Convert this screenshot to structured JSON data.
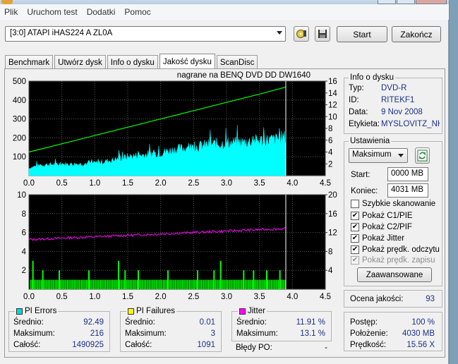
{
  "menu": [
    "Plik",
    "Uruchom test",
    "Dodatki",
    "Pomoc"
  ],
  "toolbar": {
    "drive": "[3:0]   ATAPI iHAS224   A ZL0A",
    "start_label": "Start",
    "exit_label": "Zakończ"
  },
  "tabs": [
    "Benchmark",
    "Utwórz dysk",
    "Info o dysku",
    "Jakość dysku",
    "ScanDisc"
  ],
  "active_tab": "Jakość dysku",
  "chart_caption": "nagrane na BENQ     DVD DD DW1640",
  "chart_data": [
    {
      "type": "area",
      "series": [
        {
          "name": "PI Errors",
          "color": "#00ffff",
          "x": [
            0.0,
            0.1,
            0.25,
            0.5,
            0.75,
            1.0,
            1.25,
            1.5,
            1.75,
            2.0,
            2.25,
            2.5,
            2.75,
            3.0,
            3.25,
            3.5,
            3.75,
            3.85,
            3.9
          ],
          "y": [
            40,
            50,
            58,
            60,
            62,
            66,
            80,
            100,
            110,
            120,
            140,
            150,
            165,
            170,
            175,
            185,
            190,
            200,
            200
          ]
        },
        {
          "name": "Read speed",
          "color": "#00ff00",
          "x": [
            0.0,
            0.5,
            1.0,
            1.5,
            2.0,
            2.5,
            3.0,
            3.5,
            3.9
          ],
          "y": [
            4.0,
            5.4,
            6.8,
            8.2,
            9.6,
            11.0,
            12.4,
            13.8,
            15.0
          ]
        }
      ],
      "xlim": [
        0.0,
        4.5
      ],
      "ylim_left": [
        0,
        500
      ],
      "ylim_right": [
        0,
        16
      ],
      "x_ticks": [
        "0.0",
        "0.5",
        "1.0",
        "1.5",
        "2.0",
        "2.5",
        "3.0",
        "3.5",
        "4.0",
        "4.5"
      ],
      "y_ticks_left": [
        "100",
        "200",
        "300",
        "400",
        "500"
      ],
      "y_ticks_right": [
        "2",
        "4",
        "6",
        "8",
        "10",
        "12",
        "14",
        "16"
      ]
    },
    {
      "type": "bar",
      "series": [
        {
          "name": "PI Failures",
          "color": "#00ff00",
          "x": [
            0.05,
            0.2,
            0.45,
            0.9,
            1.35,
            1.45,
            1.65,
            2.1,
            2.55,
            2.8,
            2.9,
            3.25,
            3.4,
            3.6,
            3.8
          ],
          "y": [
            3,
            2,
            2,
            2,
            3,
            2,
            2,
            2,
            2,
            2,
            3,
            2,
            2,
            2,
            2
          ],
          "baseline": 1
        },
        {
          "name": "Jitter",
          "color": "#ff00ff",
          "x": [
            0.0,
            0.5,
            1.0,
            1.5,
            2.0,
            2.5,
            3.0,
            3.5,
            3.9
          ],
          "y": [
            10.5,
            10.8,
            11.1,
            11.4,
            11.7,
            12.0,
            12.3,
            12.6,
            12.8
          ]
        }
      ],
      "xlim": [
        0.0,
        4.5
      ],
      "ylim_left": [
        0,
        10
      ],
      "ylim_right": [
        0,
        20
      ],
      "x_ticks": [
        "0.0",
        "0.5",
        "1.0",
        "1.5",
        "2.0",
        "2.5",
        "3.0",
        "3.5",
        "4.0",
        "4.5"
      ],
      "y_ticks_left": [
        "2",
        "4",
        "6",
        "8",
        "10"
      ],
      "y_ticks_right": [
        "4",
        "8",
        "12",
        "16",
        "20"
      ]
    }
  ],
  "pi_errors": {
    "title": "PI Errors",
    "color": "#00d8d8",
    "avg_label": "Średnio:",
    "avg": "92.49",
    "max_label": "Maksimum:",
    "max": "216",
    "total_label": "Całość:",
    "total": "1490925"
  },
  "pi_failures": {
    "title": "PI Failures",
    "color": "#ffff00",
    "avg_label": "Średnio:",
    "avg": "0.01",
    "max_label": "Maksimum:",
    "max": "3",
    "total_label": "Całość:",
    "total": "1091"
  },
  "jitter": {
    "title": "Jitter",
    "color": "#ff00ff",
    "avg_label": "Średnio:",
    "avg": "11.91 %",
    "max_label": "Maksimum:",
    "max": "13.1 %",
    "po_label": "Błędy PO:",
    "po": "-"
  },
  "disc_info": {
    "title": "Info o dysku",
    "type_label": "Typ:",
    "type": "DVD-R",
    "id_label": "ID:",
    "id": "RITEKF1",
    "date_label": "Data:",
    "date": "9 Nov 2008",
    "label_label": "Etykieta:",
    "label": "MYSLOVITZ_NK"
  },
  "settings": {
    "title": "Ustawienia",
    "speed": "Maksimum",
    "start_label": "Start:",
    "start": "0000 MB",
    "end_label": "Koniec:",
    "end": "4031 MB",
    "checks": [
      {
        "label": "Szybkie skanowanie",
        "checked": false,
        "disabled": false
      },
      {
        "label": "Pokaż C1/PIE",
        "checked": true,
        "disabled": false
      },
      {
        "label": "Pokaż C2/PIF",
        "checked": true,
        "disabled": false
      },
      {
        "label": "Pokaż Jitter",
        "checked": true,
        "disabled": false
      },
      {
        "label": "Pokaż prędk. odczytu",
        "checked": true,
        "disabled": false
      },
      {
        "label": "Pokaż prędk. zapisu",
        "checked": true,
        "disabled": true
      }
    ],
    "advanced_label": "Zaawansowane"
  },
  "quality": {
    "label": "Ocena jakości:",
    "value": "93"
  },
  "progress": {
    "progress_label": "Postęp:",
    "progress": "100 %",
    "position_label": "Położenie:",
    "position": "4030 MB",
    "speed_label": "Prędkość:",
    "speed": "15.56 X"
  }
}
